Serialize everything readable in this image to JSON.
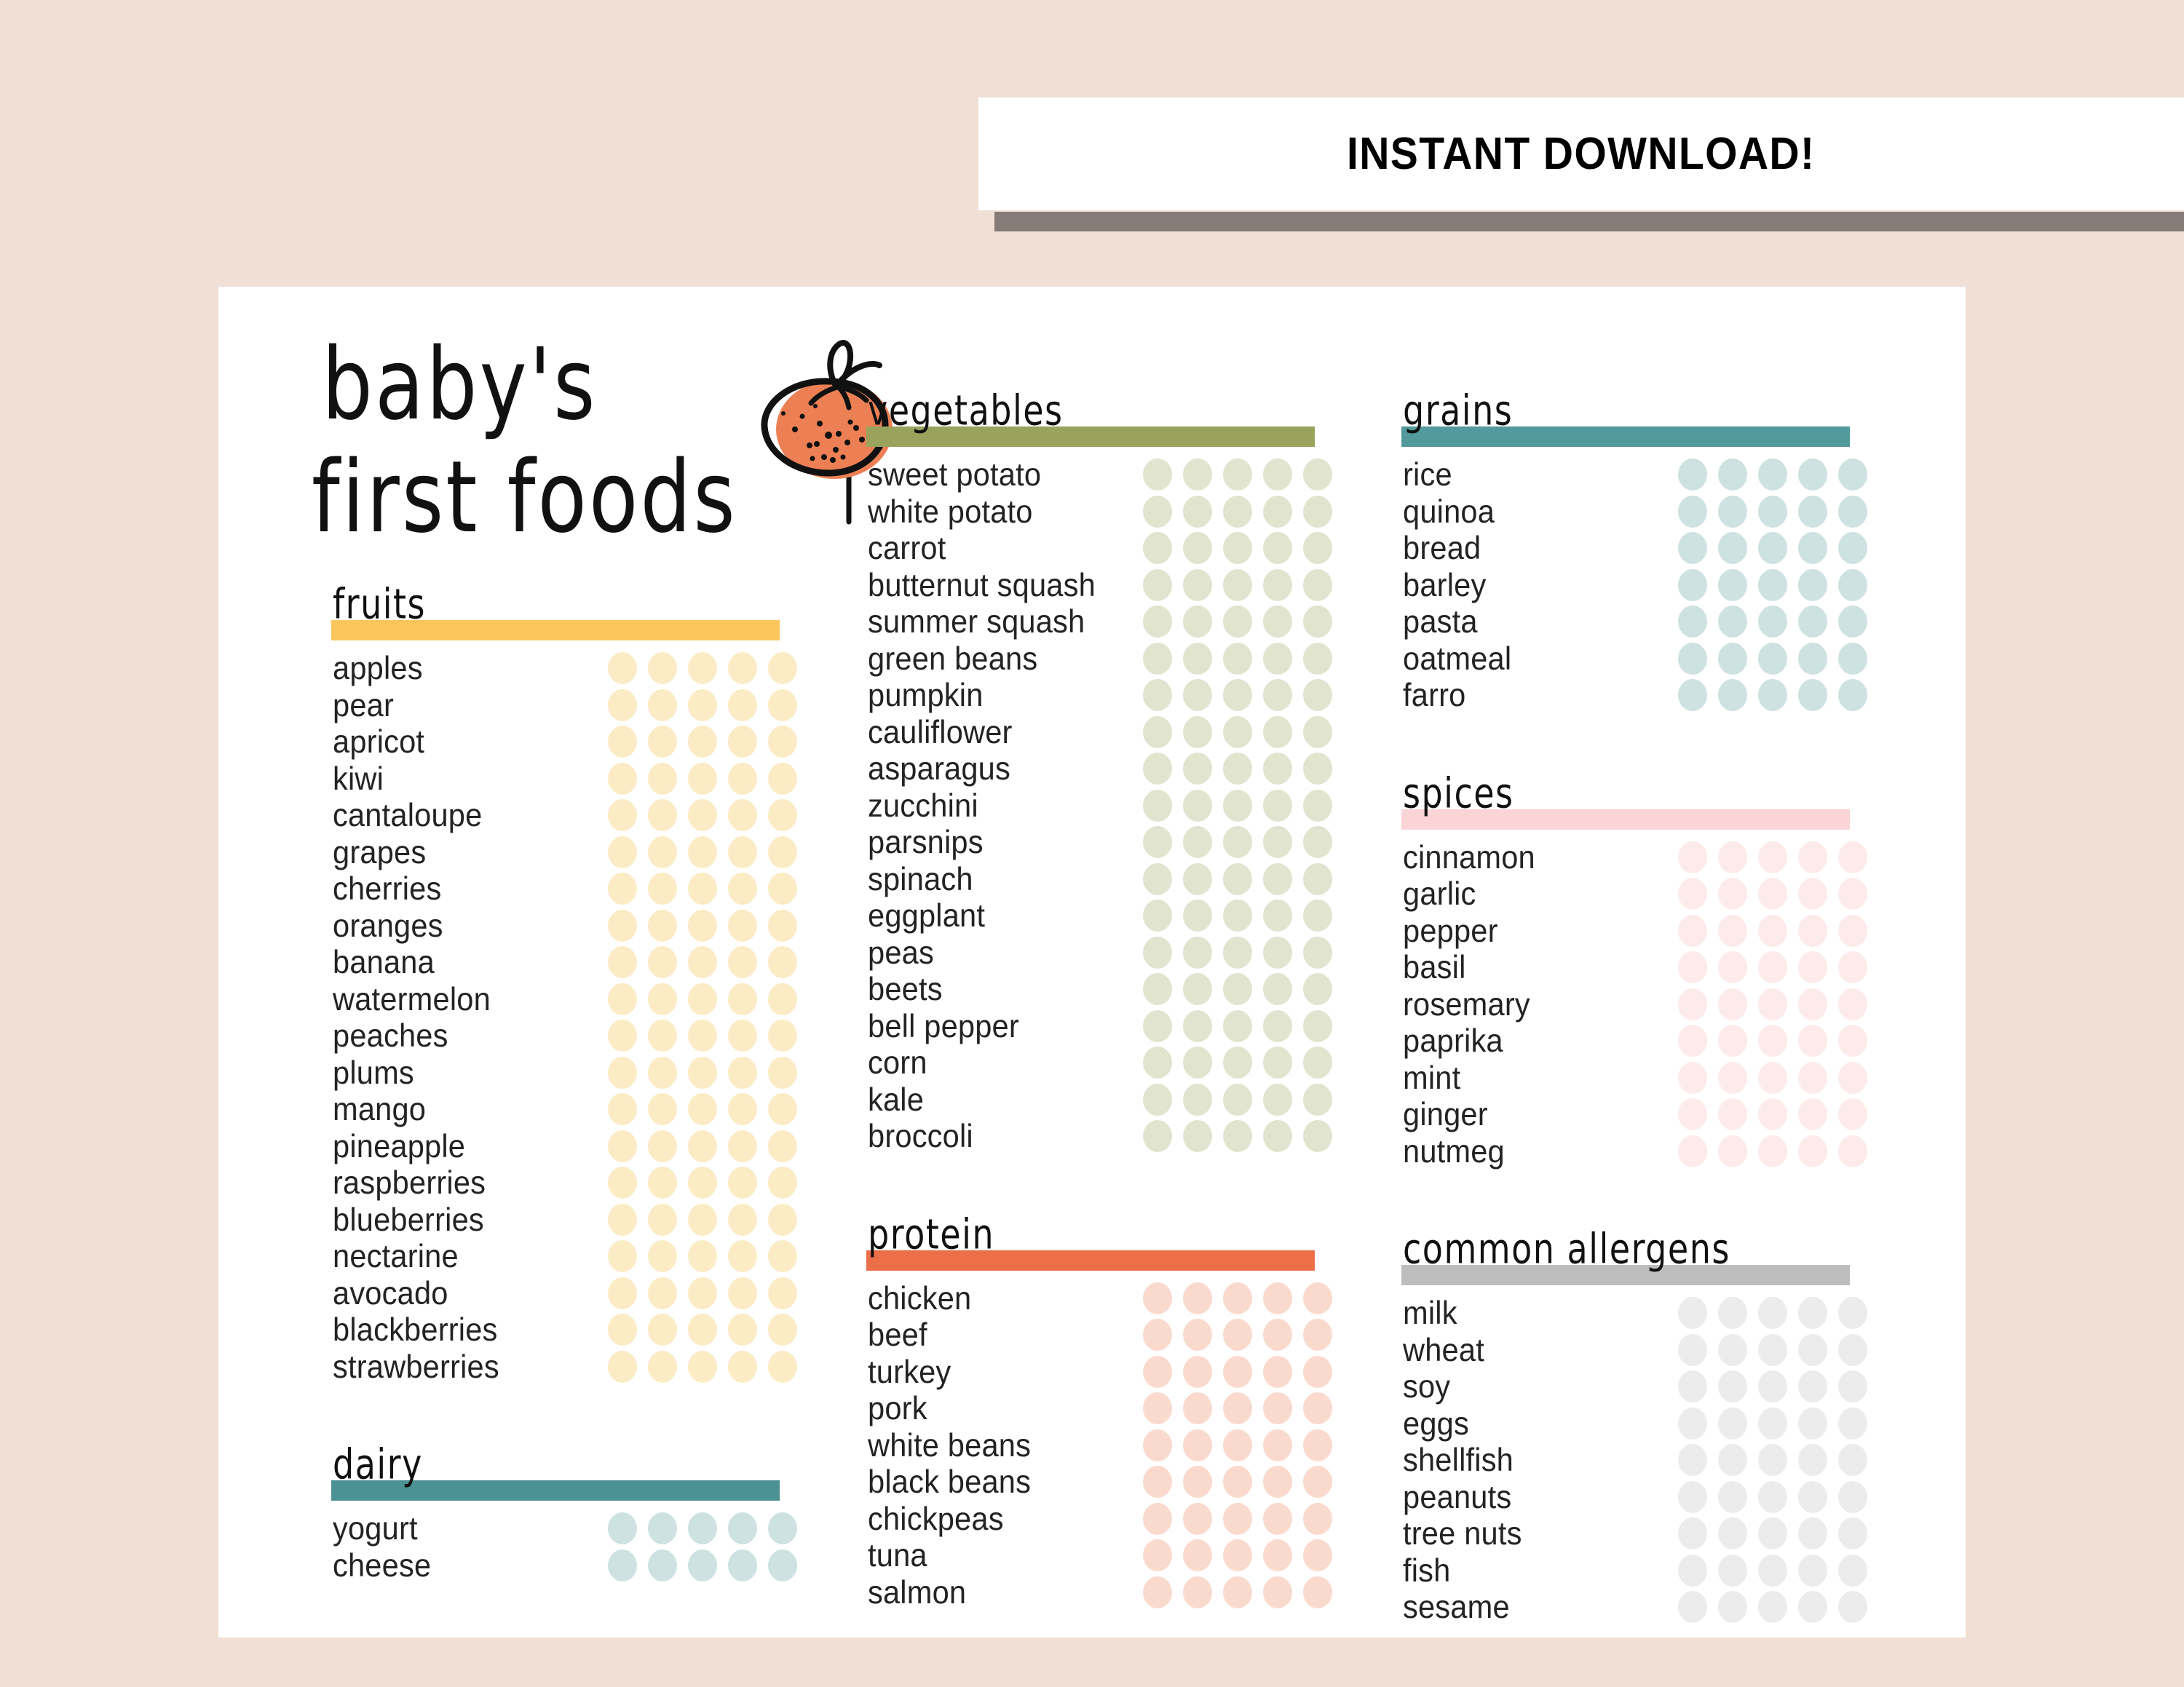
{
  "banner": {
    "text": "INSTANT DOWNLOAD!",
    "bg": "#FFFFFF",
    "shadow_color": "#857C78"
  },
  "page_bg": "#EFDFD4",
  "sheet_bg": "#FFFFFF",
  "title": {
    "line1": "baby's",
    "line2": "first foods",
    "icon": "orange-fruit-illustration",
    "icon_fill": "#EC8054"
  },
  "columns": {
    "left": [
      {
        "key": "fruits",
        "title": "fruits",
        "bar_color": "#FBC55E",
        "dot_color": "#FCECC6",
        "dots_per_row": 5,
        "items": [
          "apples",
          "pear",
          "apricot",
          "kiwi",
          "cantaloupe",
          "grapes",
          "cherries",
          "oranges",
          "banana",
          "watermelon",
          "peaches",
          "plums",
          "mango",
          "pineapple",
          "raspberries",
          "blueberries",
          "nectarine",
          "avocado",
          "blackberries",
          "strawberries"
        ]
      },
      {
        "key": "dairy",
        "title": "dairy",
        "bar_color": "#4C9193",
        "dot_color": "#CDE2E1",
        "dots_per_row": 5,
        "items": [
          "yogurt",
          "cheese"
        ]
      }
    ],
    "middle": [
      {
        "key": "vegetables",
        "title": "vegetables",
        "bar_color": "#9AA35C",
        "dot_color": "#E1E4CE",
        "dots_per_row": 5,
        "items": [
          "sweet potato",
          "white potato",
          "carrot",
          "butternut squash",
          "summer squash",
          "green beans",
          "pumpkin",
          "cauliflower",
          "asparagus",
          "zucchini",
          "parsnips",
          "spinach",
          "eggplant",
          "peas",
          "beets",
          "bell pepper",
          "corn",
          "kale",
          "broccoli"
        ]
      },
      {
        "key": "protein",
        "title": "protein",
        "bar_color": "#EC6F4A",
        "dot_color": "#FBDACE",
        "dots_per_row": 5,
        "items": [
          "chicken",
          "beef",
          "turkey",
          "pork",
          "white beans",
          "black beans",
          "chickpeas",
          "tuna",
          "salmon"
        ]
      }
    ],
    "right": [
      {
        "key": "grains",
        "title": "grains",
        "bar_color": "#539A9C",
        "dot_color": "#CDE2E1",
        "dots_per_row": 5,
        "items": [
          "rice",
          "quinoa",
          "bread",
          "barley",
          "pasta",
          "oatmeal",
          "farro"
        ]
      },
      {
        "key": "spices",
        "title": "spices",
        "bar_color": "#FAD4D7",
        "dot_color": "#FCEBEA",
        "dots_per_row": 5,
        "items": [
          "cinnamon",
          "garlic",
          "pepper",
          "basil",
          "rosemary",
          "paprika",
          "mint",
          "ginger",
          "nutmeg"
        ]
      },
      {
        "key": "common_allergens",
        "title": "common allergens",
        "bar_color": "#BDBDBD",
        "dot_color": "#ECECEC",
        "dots_per_row": 5,
        "items": [
          "milk",
          "wheat",
          "soy",
          "eggs",
          "shellfish",
          "peanuts",
          "tree nuts",
          "fish",
          "sesame"
        ]
      }
    ]
  }
}
